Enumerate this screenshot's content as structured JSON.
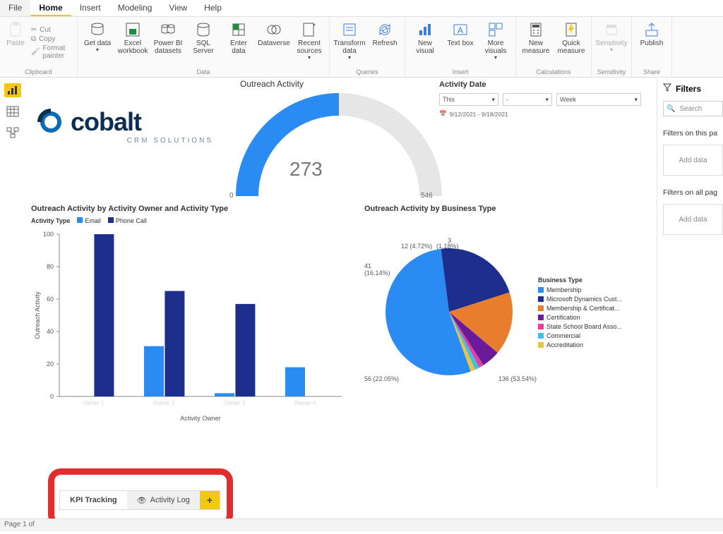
{
  "menu": {
    "file": "File",
    "home": "Home",
    "insert": "Insert",
    "modeling": "Modeling",
    "view": "View",
    "help": "Help"
  },
  "ribbon": {
    "clipboard": {
      "paste": "Paste",
      "cut": "Cut",
      "copy": "Copy",
      "format_painter": "Format painter",
      "group": "Clipboard"
    },
    "data": {
      "get_data": "Get data",
      "excel": "Excel workbook",
      "pbi": "Power BI datasets",
      "sql": "SQL Server",
      "enter": "Enter data",
      "dataverse": "Dataverse",
      "recent": "Recent sources",
      "group": "Data"
    },
    "queries": {
      "transform": "Transform data",
      "refresh": "Refresh",
      "group": "Queries"
    },
    "insert": {
      "new_visual": "New visual",
      "text_box": "Text box",
      "more": "More visuals",
      "group": "Insert"
    },
    "calc": {
      "new_measure": "New measure",
      "quick": "Quick measure",
      "group": "Calculations"
    },
    "sensitivity": {
      "label": "Sensitivity",
      "group": "Sensitivity"
    },
    "share": {
      "publish": "Publish",
      "group": "Share"
    }
  },
  "report": {
    "logo_brand": "cobalt",
    "logo_sub": "CRM SOLUTIONS",
    "gauge_title": "Outreach Activity",
    "gauge_value": "273",
    "gauge_min": "0",
    "gauge_max": "546",
    "date_header": "Activity Date",
    "date_sel1": "This",
    "date_sel2": "-",
    "date_sel3": "Week",
    "date_range": "9/12/2021 - 9/18/2021",
    "bar_title": "Outreach Activity by Activity Owner and Activity Type",
    "bar_legend_label": "Activity Type",
    "pie_title": "Outreach Activity by Business Type",
    "pie_legend_title": "Business Type",
    "x_axis_label": "Activity Owner",
    "y_axis_label": "Outreach Activity"
  },
  "chart_data": [
    {
      "type": "gauge",
      "title": "Outreach Activity",
      "value": 273,
      "min": 0,
      "max": 546
    },
    {
      "type": "bar",
      "title": "Outreach Activity by Activity Owner and Activity Type",
      "xlabel": "Activity Owner",
      "ylabel": "Outreach Activity",
      "ylim": [
        0,
        100
      ],
      "categories": [
        "Owner 1",
        "Owner 2",
        "Owner 3",
        "Owner 4"
      ],
      "series": [
        {
          "name": "Email",
          "color": "#2a8bf2",
          "values": [
            0,
            31,
            2,
            18
          ]
        },
        {
          "name": "Phone Call",
          "color": "#1e2e8c",
          "values": [
            102,
            65,
            57,
            0
          ]
        }
      ]
    },
    {
      "type": "pie",
      "title": "Outreach Activity by Business Type",
      "slices": [
        {
          "label": "Membership",
          "value": 136,
          "pct": 53.54,
          "color": "#2a8bf2"
        },
        {
          "label": "Microsoft Dynamics Cust...",
          "value": 56,
          "pct": 22.05,
          "color": "#1e2e8c"
        },
        {
          "label": "Membership & Certificat...",
          "value": 41,
          "pct": 16.14,
          "color": "#e87d2e"
        },
        {
          "label": "Certification",
          "value": 12,
          "pct": 4.72,
          "color": "#6a1b9a"
        },
        {
          "label": "State School Board Asso...",
          "value": 3,
          "pct": 1.18,
          "color": "#e63fa1"
        },
        {
          "label": "Commercial",
          "value": null,
          "pct": null,
          "color": "#3fc1e6"
        },
        {
          "label": "Accreditation",
          "value": null,
          "pct": null,
          "color": "#e6c63f"
        }
      ]
    }
  ],
  "tabs": {
    "kpi": "KPI Tracking",
    "log": "Activity Log"
  },
  "status": "Page 1 of",
  "filters": {
    "title": "Filters",
    "search": "Search",
    "on_page": "Filters on this pa",
    "add1": "Add data",
    "on_all": "Filters on all pag",
    "add2": "Add data"
  }
}
